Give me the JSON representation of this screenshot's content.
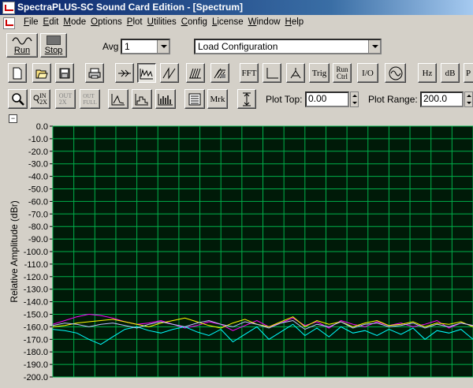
{
  "window": {
    "title": "SpectraPLUS-SC Sound Card Edition - [Spectrum]"
  },
  "menu": [
    "File",
    "Edit",
    "Mode",
    "Options",
    "Plot",
    "Utilities",
    "Config",
    "License",
    "Window",
    "Help"
  ],
  "toolbar1": {
    "run_label": "Run",
    "stop_label": "Stop",
    "avg_label": "Avg",
    "avg_value": "1",
    "config_value": "Load Configuration"
  },
  "toolbar2": {
    "fft_label": "FFT",
    "trig_label": "Trig",
    "run_ctrl_label": "Run\nCtrl",
    "io_label": "I/O",
    "hz_label": "Hz",
    "db_label": "dB",
    "p_label": "P"
  },
  "toolbar3": {
    "zoom_in_label": "IN\n2X",
    "zoom_out_label": "OUT\n2X",
    "zoom_full_label": "OUT\nFULL",
    "mrk_label": "Mrk",
    "plot_top_label": "Plot Top:",
    "plot_top_value": "0.00",
    "plot_range_label": "Plot Range:",
    "plot_range_value": "200.0"
  },
  "plot": {
    "collapse_glyph": "−",
    "ylabel": "Relative Amplitude (dBr)",
    "y_ticks": [
      "0.0",
      "-10.0",
      "-20.0",
      "-30.0",
      "-40.0",
      "-50.0",
      "-60.0",
      "-70.0",
      "-80.0",
      "-90.0",
      "-100.0",
      "-110.0",
      "-120.0",
      "-130.0",
      "-140.0",
      "-150.0",
      "-160.0",
      "-170.0",
      "-180.0",
      "-190.0",
      "-200.0"
    ],
    "background": "#001a08",
    "grid_color": "#00b04a",
    "trace_colors": [
      "#ff00ff",
      "#ffff00",
      "#00ffff",
      "#c0c0ff"
    ]
  },
  "chart_data": {
    "type": "line",
    "ylabel": "Relative Amplitude (dBr)",
    "ylim": [
      -200,
      0
    ],
    "grid": true,
    "series": [
      {
        "values": [
          -158,
          -155,
          -152,
          -150,
          -151,
          -153,
          -156,
          -158,
          -157,
          -155,
          -158,
          -161,
          -159,
          -156,
          -158,
          -163,
          -159,
          -155,
          -160,
          -157,
          -153,
          -159,
          -156,
          -161,
          -155,
          -158,
          -160,
          -156,
          -159,
          -157,
          -160,
          -158,
          -155,
          -161,
          -157,
          -159
        ]
      },
      {
        "values": [
          -160,
          -159,
          -157,
          -156,
          -155,
          -154,
          -156,
          -158,
          -160,
          -157,
          -155,
          -153,
          -156,
          -159,
          -161,
          -157,
          -154,
          -158,
          -160,
          -156,
          -152,
          -160,
          -155,
          -158,
          -156,
          -160,
          -157,
          -155,
          -159,
          -158,
          -156,
          -160,
          -157,
          -158,
          -156,
          -160
        ]
      },
      {
        "values": [
          -162,
          -163,
          -165,
          -170,
          -174,
          -168,
          -162,
          -160,
          -163,
          -165,
          -162,
          -160,
          -164,
          -167,
          -162,
          -172,
          -166,
          -160,
          -170,
          -164,
          -158,
          -167,
          -161,
          -168,
          -160,
          -165,
          -163,
          -167,
          -162,
          -166,
          -161,
          -170,
          -163,
          -165,
          -162,
          -170
        ]
      },
      {
        "values": [
          -159,
          -157,
          -158,
          -160,
          -158,
          -157,
          -159,
          -161,
          -158,
          -156,
          -158,
          -160,
          -157,
          -155,
          -158,
          -160,
          -156,
          -158,
          -161,
          -157,
          -155,
          -162,
          -158,
          -160,
          -156,
          -161,
          -158,
          -157,
          -160,
          -159,
          -157,
          -161,
          -158,
          -160,
          -157,
          -159
        ]
      }
    ]
  }
}
